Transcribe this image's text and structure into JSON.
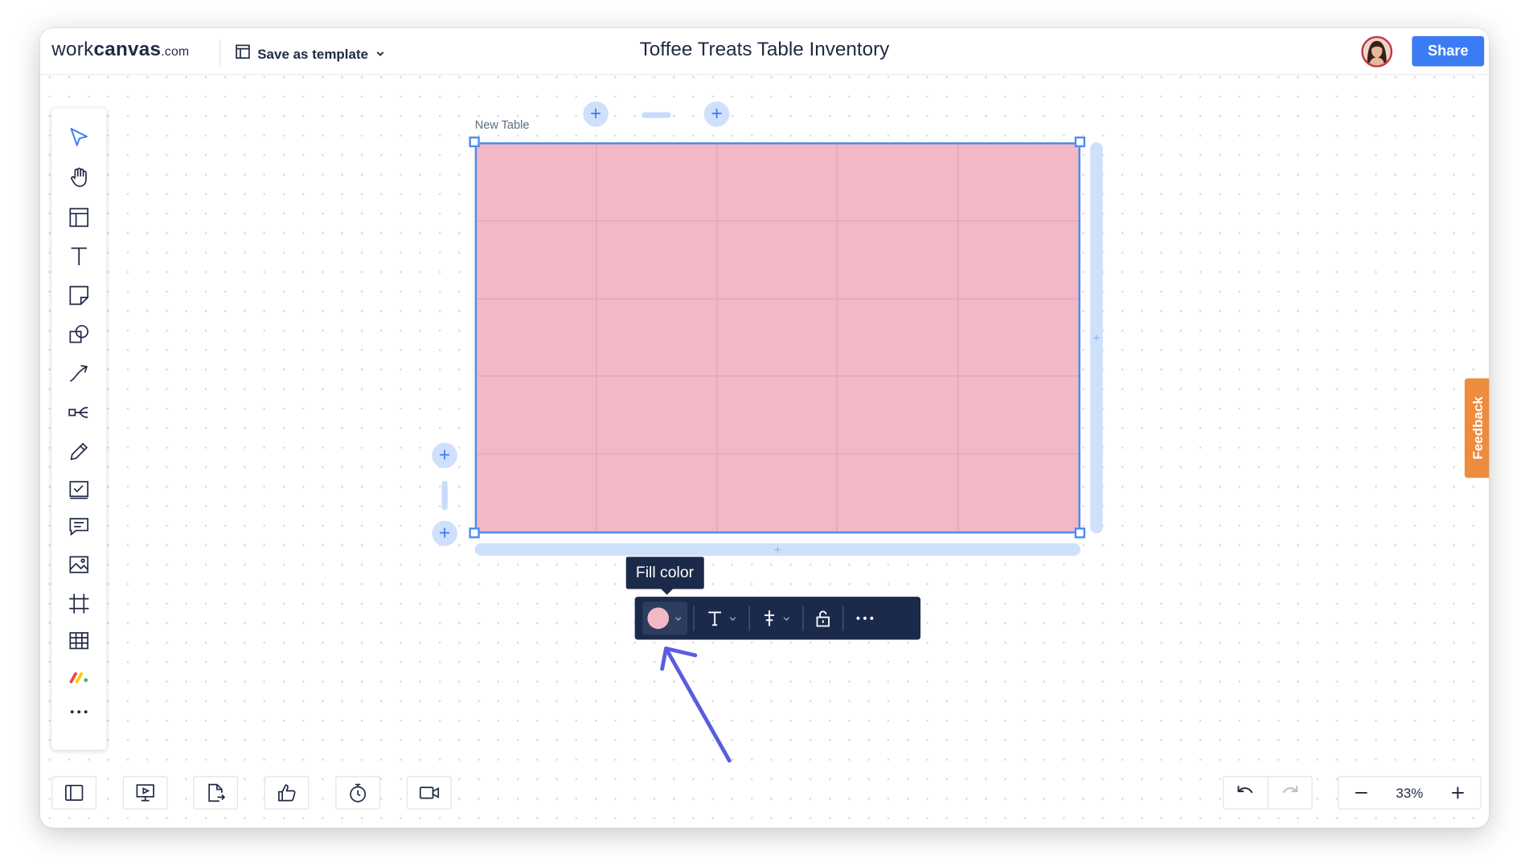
{
  "brand": {
    "logo_light": "work",
    "logo_bold": "canvas",
    "logo_domain": ".com"
  },
  "header": {
    "save_template_label": "Save as template",
    "document_title": "Toffee Treats Table Inventory",
    "share_label": "Share"
  },
  "left_toolbar": {
    "tools": [
      "select-arrow-icon",
      "hand-icon",
      "template-icon",
      "text-icon",
      "sticky-note-icon",
      "shapes-icon",
      "connector-icon",
      "mind-map-icon",
      "pen-icon",
      "checklist-icon",
      "comment-icon",
      "image-icon",
      "frame-icon",
      "table-icon",
      "integration-icon",
      "more-icon"
    ]
  },
  "canvas": {
    "table": {
      "label": "New Table",
      "rows": 5,
      "columns": 5,
      "fill_color": "#f2b8c6",
      "selection_color": "#4a8cf2"
    }
  },
  "context_toolbar": {
    "tooltip": "Fill color",
    "items": [
      "fill-color-picker",
      "text-style-menu",
      "alignment-menu",
      "lock-toggle",
      "more-options"
    ]
  },
  "feedback_tab": {
    "label": "Feedback"
  },
  "bottom_bar": {
    "buttons": [
      "panel-toggle-icon",
      "presentation-icon",
      "export-icon",
      "reactions-icon",
      "timer-icon",
      "video-icon"
    ],
    "zoom_value": "33%"
  },
  "colors": {
    "accent": "#3b7cf5",
    "dark_toolbar": "#1b2a4a",
    "feedback": "#ec8c3c",
    "annotation_arrow": "#5a5ce0"
  }
}
